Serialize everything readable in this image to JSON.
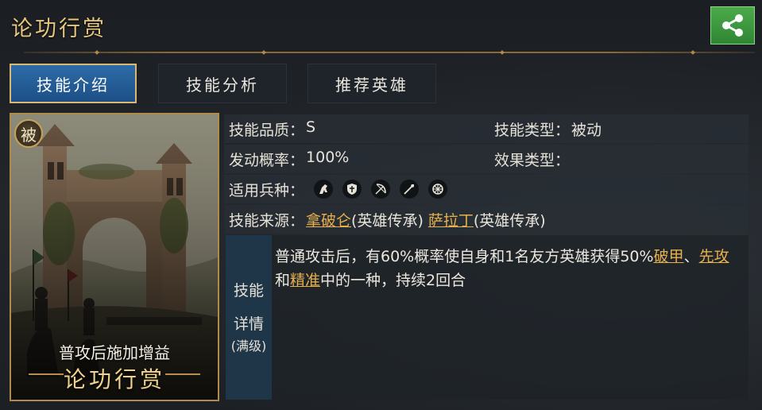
{
  "header": {
    "title": "论功行赏"
  },
  "tabs": [
    {
      "label": "技能介绍",
      "active": true
    },
    {
      "label": "技能分析",
      "active": false
    },
    {
      "label": "推荐英雄",
      "active": false
    }
  ],
  "card": {
    "badge": "被",
    "caption": "普攻后施加增益",
    "name": "论功行赏"
  },
  "info": {
    "quality_label": "技能品质：",
    "quality_value": "S",
    "type_label": "技能类型：",
    "type_value": "被动",
    "rate_label": "发动概率：",
    "rate_value": "100%",
    "effect_label": "效果类型：",
    "effect_value": "",
    "troops_label": "适用兵种：",
    "troops": [
      "cavalry-icon",
      "shield-infantry-icon",
      "archer-bow-icon",
      "spear-icon",
      "chariot-wheel-icon"
    ],
    "source_label": "技能来源：",
    "sources": [
      {
        "hero": "拿破仑",
        "note": "(英雄传承)"
      },
      {
        "hero": "萨拉丁",
        "note": "(英雄传承)"
      }
    ]
  },
  "detail": {
    "label_line1": "技能",
    "label_line2": "详情",
    "label_line3": "(满级)",
    "text_part1": "普通攻击后，有60%概率使自身和1名友方英雄获得50%",
    "link1": "破甲",
    "sep1": "、",
    "link2": "先攻",
    "sep2": "和",
    "link3": "精准",
    "text_part2": "中的一种，持续2回合"
  },
  "colors": {
    "accent_gold": "#e8c77c",
    "link": "#e6b04c",
    "tab_active": "#2d6ca8",
    "share_green": "#3f9c42"
  }
}
